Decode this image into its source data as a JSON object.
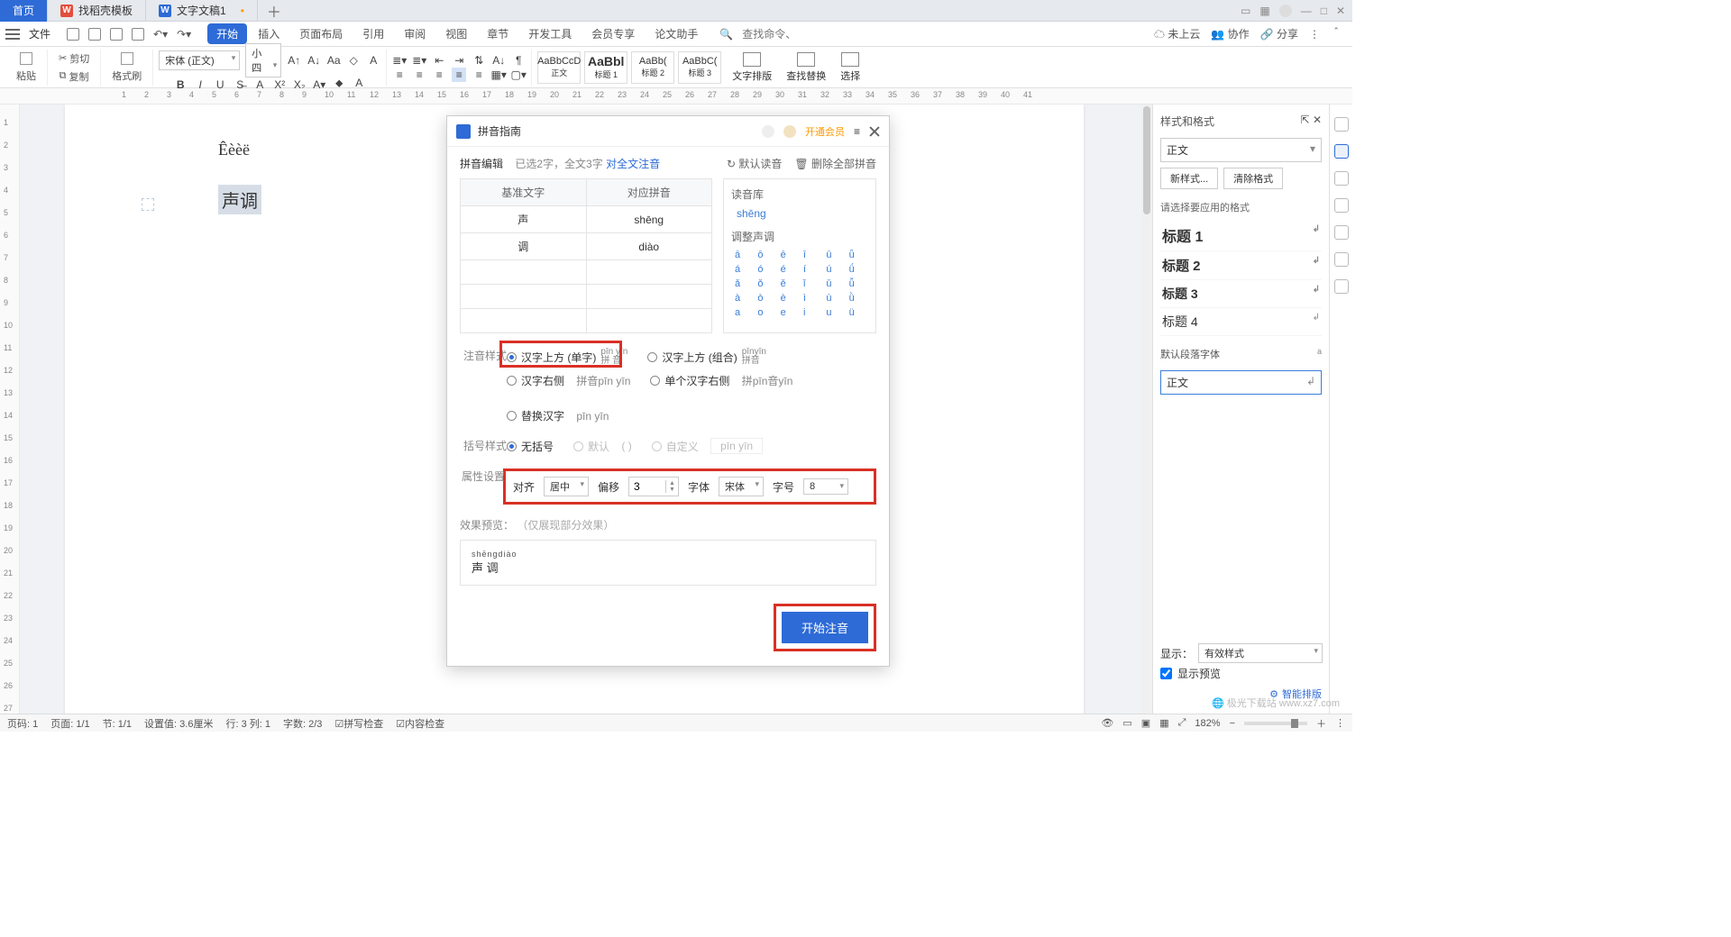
{
  "tabs": {
    "home": "首页",
    "t1": "找稻壳模板",
    "t2": "文字文稿1"
  },
  "menu": {
    "file": "文件",
    "items": [
      "开始",
      "插入",
      "页面布局",
      "引用",
      "审阅",
      "视图",
      "章节",
      "开发工具",
      "会员专享",
      "论文助手"
    ],
    "search_ph": "查找命令、搜索模板",
    "cloud": "未上云",
    "collab": "协作",
    "share": "分享"
  },
  "ribbon": {
    "paste": "粘贴",
    "cut": "剪切",
    "copy": "复制",
    "fmt": "格式刷",
    "font": "宋体 (正文)",
    "size": "小四",
    "styles": [
      {
        "p": "AaBbCcD",
        "n": "正文"
      },
      {
        "p": "AaBbl",
        "n": "标题 1"
      },
      {
        "p": "AaBb(",
        "n": "标题 2"
      },
      {
        "p": "AaBbC(",
        "n": "标题 3"
      }
    ],
    "layout": "文字排版",
    "find": "查找替换",
    "select": "选择"
  },
  "doc": {
    "line1": "Êèèë",
    "line2": "声调"
  },
  "dialog": {
    "title": "拼音指南",
    "vip": "开通会员",
    "editor_label": "拼音编辑",
    "selected": "已选2字，全文3字",
    "full_link": "对全文注音",
    "default_read": "默认读音",
    "clear_all": "删除全部拼音",
    "th1": "基准文字",
    "th2": "对应拼音",
    "rows": [
      {
        "c": "声",
        "p": "shēng"
      },
      {
        "c": "调",
        "p": "diào"
      }
    ],
    "reading_lib": "读音库",
    "reading": "shēng",
    "adjust_tone": "调整声调",
    "tones": [
      "ā",
      "ō",
      "ē",
      "ī",
      "ū",
      "ǖ",
      "á",
      "ó",
      "é",
      "í",
      "ú",
      "ǘ",
      "ǎ",
      "ǒ",
      "ě",
      "ǐ",
      "ǔ",
      "ǚ",
      "à",
      "ò",
      "è",
      "ì",
      "ù",
      "ǜ",
      "a",
      "o",
      "e",
      "i",
      "u",
      "ü"
    ],
    "style_label": "注音样式",
    "opt1": "汉字上方 (单字)",
    "opt1_hint_t": "pīn yīn",
    "opt1_hint_b": "拼 音",
    "opt2": "汉字上方 (组合)",
    "opt2_hint_t": "pīnyīn",
    "opt2_hint_b": "拼音",
    "opt3": "汉字右侧",
    "opt3_hint": "拼音pīn yīn",
    "opt4": "单个汉字右侧",
    "opt4_hint": "拼pīn音yīn",
    "opt5": "替换汉字",
    "opt5_hint": "pīn yīn",
    "bracket_label": "括号样式",
    "b1": "无括号",
    "b2": "默认",
    "b2_hint": "( )",
    "b3": "自定义",
    "b3_hint": "pīn yīn",
    "attr_label": "属性设置",
    "align": "对齐",
    "align_v": "居中",
    "offset": "偏移",
    "offset_v": "3",
    "font": "字体",
    "font_v": "宋体",
    "fsize": "字号",
    "fsize_v": "8",
    "preview_label": "效果预览：",
    "preview_note": "（仅展现部分效果）",
    "preview_py": "shēngdiào",
    "preview_hz": "声  调",
    "primary": "开始注音"
  },
  "styles_panel": {
    "title": "样式和格式",
    "current": "正文",
    "new": "新样式...",
    "clear": "清除格式",
    "hint": "请选择要应用的格式",
    "items": [
      "标题 1",
      "标题 2",
      "标题 3",
      "标题 4"
    ],
    "def_para": "默认段落字体",
    "bodytext": "正文",
    "show": "显示：",
    "show_v": "有效样式",
    "preview": "显示预览",
    "smart": "智能排版"
  },
  "status": {
    "page": "页码: 1",
    "pages": "页面: 1/1",
    "sec": "节: 1/1",
    "setv": "设置值: 3.6厘米",
    "line": "行: 3 列: 1",
    "words": "字数: 2/3",
    "spell": "拼写检查",
    "content": "内容检查",
    "zoom": "182%"
  },
  "ruler_h": [
    1,
    2,
    3,
    4,
    5,
    6,
    7,
    8,
    9,
    10,
    11,
    12,
    13,
    14,
    15,
    16,
    17,
    18,
    19,
    20,
    21,
    22,
    23,
    24,
    25,
    26,
    27,
    28,
    29,
    30,
    31,
    32,
    33,
    34,
    35,
    36,
    37,
    38,
    39,
    40,
    41
  ],
  "ruler_v": [
    1,
    2,
    3,
    4,
    5,
    6,
    7,
    8,
    9,
    10,
    11,
    12,
    13,
    14,
    15,
    16,
    17,
    18,
    19,
    20,
    21,
    22,
    23,
    24,
    25,
    26,
    27
  ]
}
